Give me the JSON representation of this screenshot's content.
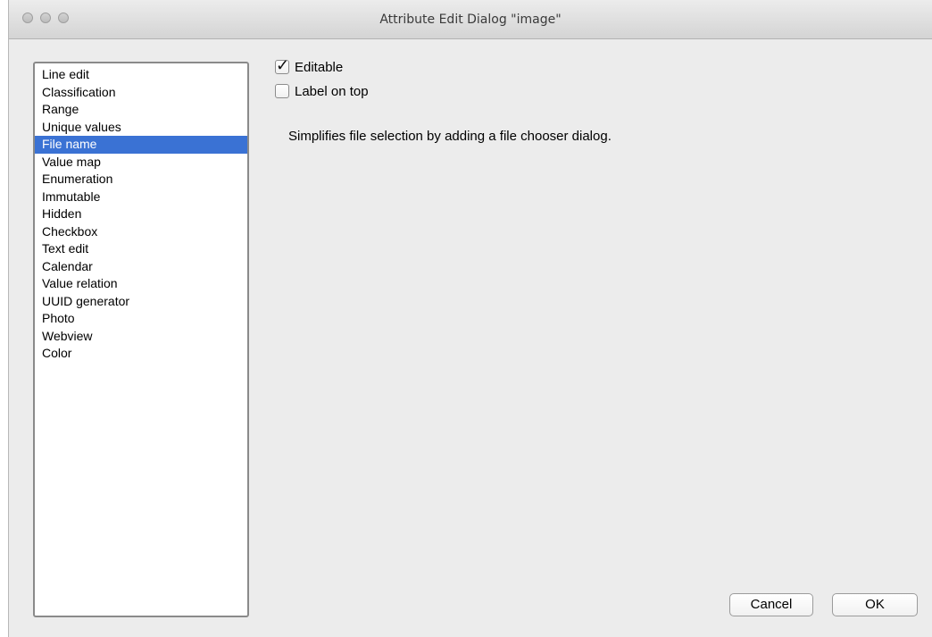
{
  "window": {
    "title": "Attribute Edit Dialog \"image\""
  },
  "widget_types": {
    "items": [
      "Line edit",
      "Classification",
      "Range",
      "Unique values",
      "File name",
      "Value map",
      "Enumeration",
      "Immutable",
      "Hidden",
      "Checkbox",
      "Text edit",
      "Calendar",
      "Value relation",
      "UUID generator",
      "Photo",
      "Webview",
      "Color"
    ],
    "selected": "File name"
  },
  "options": {
    "editable": {
      "label": "Editable",
      "checked": true
    },
    "label_on_top": {
      "label": "Label on top",
      "checked": false
    }
  },
  "description": "Simplifies file selection by adding a file chooser dialog.",
  "buttons": {
    "cancel": "Cancel",
    "ok": "OK"
  },
  "colors": {
    "selection": "#3a72d4",
    "window_bg": "#ececec"
  },
  "icons": {
    "checkmark": "checkmark-icon",
    "window_close": "close-traffic-light-icon",
    "window_minimize": "minimize-traffic-light-icon",
    "window_zoom": "zoom-traffic-light-icon"
  }
}
